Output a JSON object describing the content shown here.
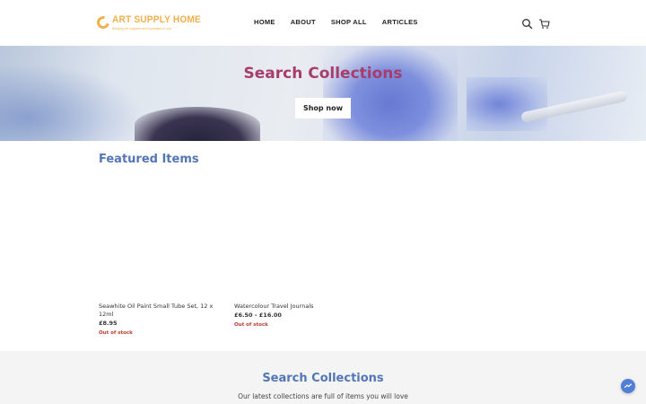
{
  "brand": {
    "name": "ART SUPPLY HOME",
    "tagline": "Bringing art supplies and inspiration to you",
    "accent_color": "#f2b04c"
  },
  "nav": {
    "items": [
      "HOME",
      "ABOUT",
      "SHOP ALL",
      "ARTICLES"
    ]
  },
  "header_icons": [
    "search-icon",
    "cart-icon"
  ],
  "hero": {
    "title": "Search Collections",
    "button_label": "Shop now"
  },
  "featured": {
    "title": "Featured Items",
    "products": [
      {
        "name": "Seawhite Oil Paint Small Tube Set, 12 x 12ml",
        "price": "£8.95",
        "stock": "Out of stock"
      },
      {
        "name": "Watercolour Travel Journals",
        "price": "£6.50 - £16.00",
        "stock": "Out of stock"
      }
    ]
  },
  "band": {
    "title": "Search Collections",
    "text": "Our latest collections are full of items you will love"
  },
  "colors": {
    "hero_title": "#a63d6d",
    "section_title": "#5276b7",
    "stock": "#c0392b",
    "messenger": "#4f7fd6"
  },
  "chat_icon": "messenger-icon"
}
